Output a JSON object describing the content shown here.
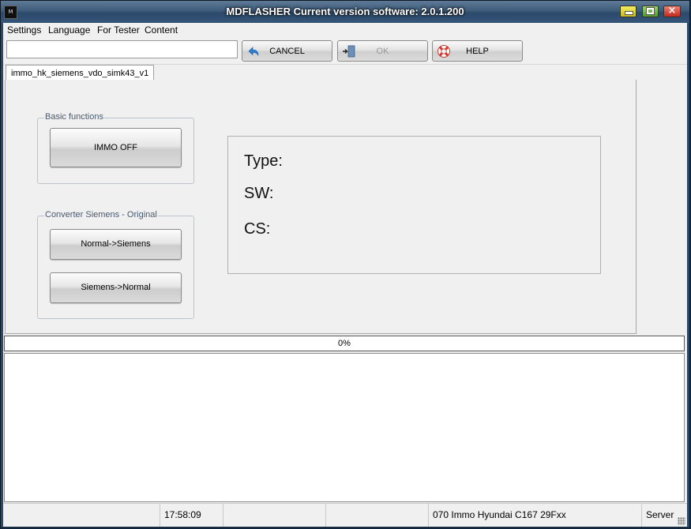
{
  "window": {
    "title": "MDFLASHER  Current version software: 2.0.1.200",
    "icon": "app-logo-icon",
    "controls": {
      "minimize": "minimize-icon",
      "maximize": "maximize-icon",
      "close": "×"
    }
  },
  "menu": [
    "Settings",
    "Language",
    "For Tester",
    "Content"
  ],
  "toolbar": {
    "input_value": "",
    "cancel_label": "CANCEL",
    "ok_label": "OK",
    "help_label": "HELP"
  },
  "tab": {
    "label": "immo_hk_siemens_vdo_simk43_v1"
  },
  "groups": {
    "basic": {
      "title": "Basic functions",
      "buttons": [
        "IMMO OFF"
      ]
    },
    "converter": {
      "title": "Converter Siemens - Original",
      "buttons": [
        "Normal->Siemens",
        "Siemens->Normal"
      ]
    }
  },
  "info": {
    "type_label": "Type:",
    "sw_label": "SW:",
    "cs_label": "CS:"
  },
  "progress": {
    "value": 0,
    "text": "0%"
  },
  "log": "",
  "status": {
    "cell1": "",
    "time": "17:58:09",
    "cell3": "",
    "cell4": "",
    "module": "070 Immo Hyundai C167 29Fxx",
    "server": "Server"
  },
  "colors": {
    "accent": "#2c4a68",
    "title_text": "#ffffff",
    "group_title": "#4a5a6e"
  }
}
